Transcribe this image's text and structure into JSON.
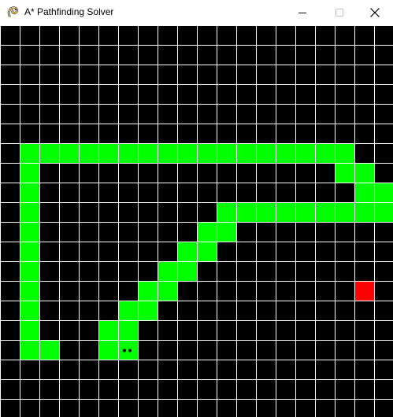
{
  "window": {
    "title": "A* Pathfinding Solver",
    "icon": "pygame-snake-icon",
    "buttons": {
      "minimize": "minimize-icon",
      "maximize": "maximize-icon",
      "close": "close-icon"
    }
  },
  "colors": {
    "background": "#000000",
    "grid_line": "#ffffff",
    "path": "#00ff00",
    "goal": "#ff0000",
    "dots": "#000000"
  },
  "grid": {
    "rows": 20,
    "cols": 20,
    "path_cells": [
      [
        1,
        6
      ],
      [
        2,
        6
      ],
      [
        3,
        6
      ],
      [
        4,
        6
      ],
      [
        5,
        6
      ],
      [
        6,
        6
      ],
      [
        7,
        6
      ],
      [
        8,
        6
      ],
      [
        9,
        6
      ],
      [
        10,
        6
      ],
      [
        11,
        6
      ],
      [
        12,
        6
      ],
      [
        13,
        6
      ],
      [
        14,
        6
      ],
      [
        15,
        6
      ],
      [
        16,
        6
      ],
      [
        17,
        6
      ],
      [
        1,
        7
      ],
      [
        17,
        7
      ],
      [
        18,
        7
      ],
      [
        1,
        8
      ],
      [
        18,
        8
      ],
      [
        19,
        8
      ],
      [
        1,
        9
      ],
      [
        11,
        9
      ],
      [
        12,
        9
      ],
      [
        13,
        9
      ],
      [
        14,
        9
      ],
      [
        15,
        9
      ],
      [
        16,
        9
      ],
      [
        17,
        9
      ],
      [
        18,
        9
      ],
      [
        19,
        9
      ],
      [
        1,
        10
      ],
      [
        10,
        10
      ],
      [
        11,
        10
      ],
      [
        1,
        11
      ],
      [
        9,
        11
      ],
      [
        10,
        11
      ],
      [
        1,
        12
      ],
      [
        8,
        12
      ],
      [
        9,
        12
      ],
      [
        1,
        13
      ],
      [
        7,
        13
      ],
      [
        8,
        13
      ],
      [
        1,
        14
      ],
      [
        6,
        14
      ],
      [
        7,
        14
      ],
      [
        1,
        15
      ],
      [
        5,
        15
      ],
      [
        6,
        15
      ],
      [
        1,
        16
      ],
      [
        2,
        16
      ],
      [
        5,
        16
      ],
      [
        6,
        16
      ]
    ],
    "goal_cell": [
      18,
      13
    ],
    "start_cell": [
      6,
      16
    ]
  }
}
